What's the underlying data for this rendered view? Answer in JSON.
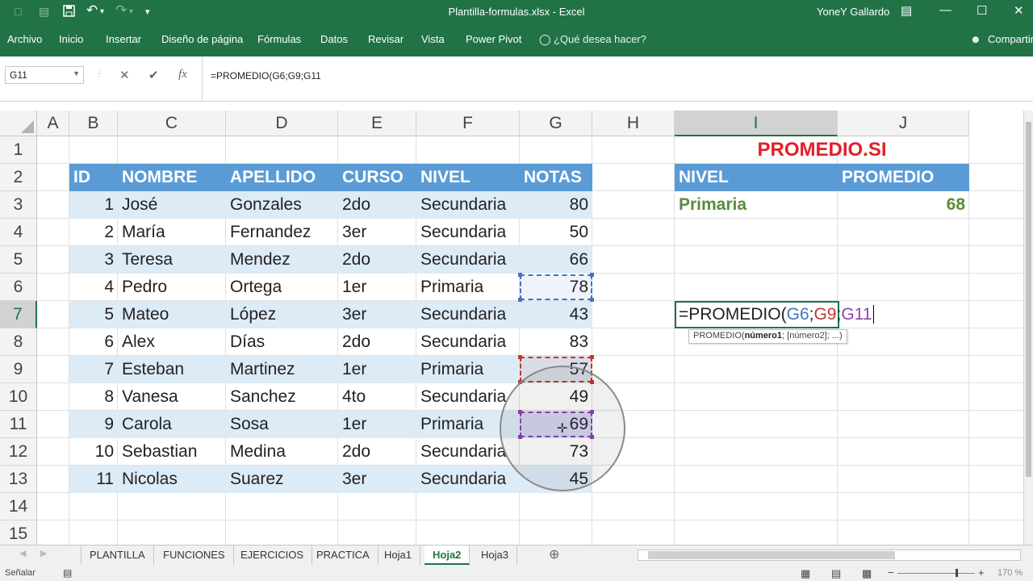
{
  "titlebar": {
    "title": "Plantilla-formulas.xlsx  -  Excel",
    "user": "YoneY Gallardo",
    "minimize": "—",
    "maximize": "☐",
    "close": "✕",
    "quick_access": [
      "🗋",
      "↶",
      "↷",
      "▾"
    ]
  },
  "ribbon": {
    "tabs": [
      "Archivo",
      "Inicio",
      "Insertar",
      "Diseño de página",
      "Fórmulas",
      "Datos",
      "Revisar",
      "Vista",
      "Power Pivot"
    ],
    "tell_me": "¿Qué desea hacer?",
    "share": "Compartir"
  },
  "formula_bar": {
    "name_box": "G11",
    "cancel_icon": "✕",
    "enter_icon": "✔",
    "fx_label": "fx",
    "formula": "=PROMEDIO(G6;G9;G11"
  },
  "columns": [
    "A",
    "B",
    "C",
    "D",
    "E",
    "F",
    "G",
    "H",
    "I",
    "J"
  ],
  "rows": [
    "1",
    "2",
    "3",
    "4",
    "5",
    "6",
    "7",
    "8",
    "9",
    "10",
    "11",
    "12",
    "13",
    "14",
    "15"
  ],
  "table": {
    "headers": [
      "ID",
      "NOMBRE",
      "APELLIDO",
      "CURSO",
      "NIVEL",
      "NOTAS"
    ],
    "rows": [
      [
        "1",
        "José",
        "Gonzales",
        "2do",
        "Secundaria",
        "80"
      ],
      [
        "2",
        "María",
        "Fernandez",
        "3er",
        "Secundaria",
        "50"
      ],
      [
        "3",
        "Teresa",
        "Mendez",
        "2do",
        "Secundaria",
        "66"
      ],
      [
        "4",
        "Pedro",
        "Ortega",
        "1er",
        "Primaria",
        "78"
      ],
      [
        "5",
        "Mateo",
        "López",
        "3er",
        "Secundaria",
        "43"
      ],
      [
        "6",
        "Alex",
        "Días",
        "2do",
        "Secundaria",
        "83"
      ],
      [
        "7",
        "Esteban",
        "Martinez",
        "1er",
        "Primaria",
        "57"
      ],
      [
        "8",
        "Vanesa",
        "Sanchez",
        "4to",
        "Secundaria",
        "49"
      ],
      [
        "9",
        "Carola",
        "Sosa",
        "1er",
        "Primaria",
        "69"
      ],
      [
        "10",
        "Sebastian",
        "Medina",
        "2do",
        "Secundaria",
        "73"
      ],
      [
        "11",
        "Nicolas",
        "Suarez",
        "3er",
        "Secundaria",
        "45"
      ]
    ]
  },
  "side_table": {
    "title": "PROMEDIO.SI",
    "headers": [
      "NIVEL",
      "PROMEDIO"
    ],
    "level": "Primaria",
    "average": "68"
  },
  "edit_cell": {
    "prefix": "=PROMEDIO(",
    "ref1": "G6",
    "sep1": ";",
    "ref2": "G9",
    "sep2": ";",
    "ref3": "G11",
    "tooltip_pre": "PROMEDIO(",
    "tooltip_bold": "número1",
    "tooltip_post": "; [número2]; ...)"
  },
  "sheet_tabs": [
    "PLANTILLA",
    "FUNCIONES",
    "EJERCICIOS",
    "PRACTICA",
    "Hoja1",
    "Hoja2",
    "Hoja3"
  ],
  "active_sheet": "Hoja2",
  "status": {
    "mode": "Señalar",
    "zoom": "170 %"
  },
  "colors": {
    "excel_green": "#217346",
    "header_blue": "#5b9bd5",
    "band_blue": "#ddebf7",
    "title_red": "#e0202a",
    "level_green": "#5a8c3a",
    "ref_blue": "#4472c4",
    "ref_red": "#c0392b",
    "ref_purple": "#8e44ad"
  }
}
